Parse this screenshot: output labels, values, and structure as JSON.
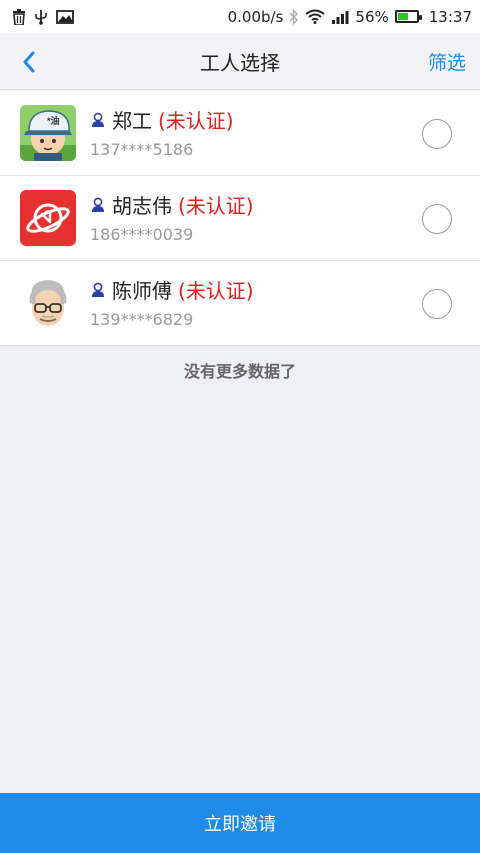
{
  "status_bar": {
    "speed": "0.00b/s",
    "battery": "56%",
    "battery_level": 0.56,
    "time": "13:37",
    "icons": [
      "trash-icon",
      "usb-icon",
      "image-icon",
      "bluetooth-icon",
      "wifi-icon",
      "signal-icon",
      "battery-icon"
    ]
  },
  "nav": {
    "back_icon": "chevron-left-icon",
    "title": "工人选择",
    "filter_label": "筛选"
  },
  "workers": [
    {
      "name": "郑工",
      "status": "(未认证)",
      "phone": "137****5186",
      "selected": false
    },
    {
      "name": "胡志伟",
      "status": "(未认证)",
      "phone": "186****0039",
      "selected": false
    },
    {
      "name": "陈师傅",
      "status": "(未认证)",
      "phone": "139****6829",
      "selected": false
    }
  ],
  "no_more_text": "没有更多数据了",
  "invite_label": "立即邀请",
  "colors": {
    "accent": "#1e8ce6",
    "link": "#2488dd",
    "unverified": "#e0211d",
    "background": "#eff0f4"
  }
}
